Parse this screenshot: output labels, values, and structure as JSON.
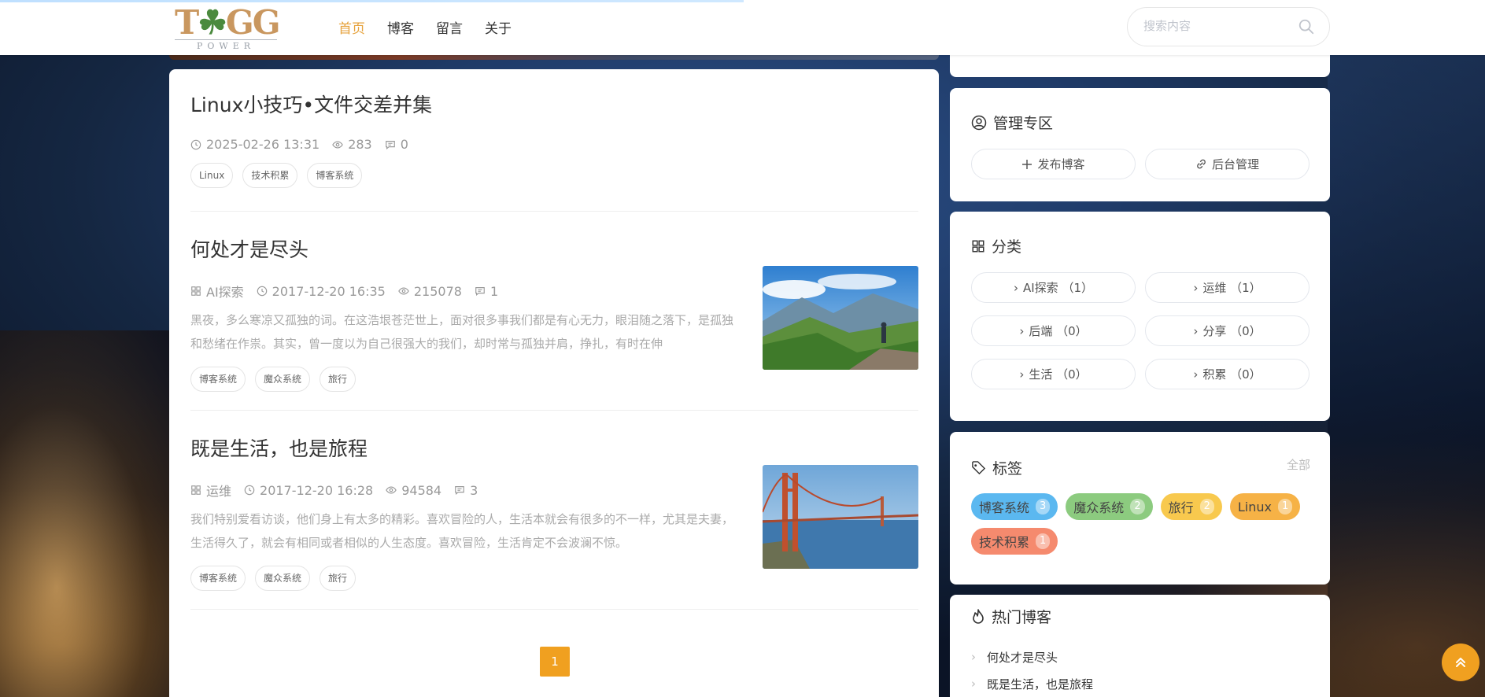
{
  "header": {
    "logo_text": "TOGG",
    "logo_sub": "POWER",
    "nav": [
      "首页",
      "博客",
      "留言",
      "关于"
    ],
    "search_placeholder": "搜索内容"
  },
  "posts": [
    {
      "title": "Linux小技巧•文件交差并集",
      "date": "2025-02-26 13:31",
      "views": "283",
      "comments": "0",
      "tags": [
        "Linux",
        "技术积累",
        "博客系统"
      ]
    },
    {
      "title": "何处才是尽头",
      "category": "AI探索",
      "date": "2017-12-20 16:35",
      "views": "215078",
      "comments": "1",
      "excerpt": "黑夜，多么寒凉又孤独的词。在这浩垠苍茫世上，面对很多事我们都是有心无力，眼泪随之落下，是孤独和愁绪在作祟。其实，曾一度以为自己很强大的我们，却时常与孤独并肩，挣扎，有时在伸",
      "tags": [
        "博客系统",
        "魔众系统",
        "旅行"
      ]
    },
    {
      "title": "既是生活，也是旅程",
      "category": "运维",
      "date": "2017-12-20 16:28",
      "views": "94584",
      "comments": "3",
      "excerpt": "我们特别爱看访谈，他们身上有太多的精彩。喜欢冒险的人，生活本就会有很多的不一样，尤其是夫妻，生活得久了，就会有相同或者相似的人生态度。喜欢冒险，生活肯定不会波澜不惊。",
      "tags": [
        "博客系统",
        "魔众系统",
        "旅行"
      ]
    }
  ],
  "pagination": {
    "current": "1"
  },
  "admin": {
    "title": "管理专区",
    "publish": "发布博客",
    "backend": "后台管理"
  },
  "categories": {
    "title": "分类",
    "items": [
      {
        "label": "AI探索 （1）"
      },
      {
        "label": "运维 （1）"
      },
      {
        "label": "后端 （0）"
      },
      {
        "label": "分享 （0）"
      },
      {
        "label": "生活 （0）"
      },
      {
        "label": "积累 （0）"
      }
    ]
  },
  "tags_panel": {
    "title": "标签",
    "all": "全部",
    "items": [
      {
        "name": "博客系统",
        "count": "3",
        "color": "#5bb8f0"
      },
      {
        "name": "魔众系统",
        "count": "2",
        "color": "#8ccb7f"
      },
      {
        "name": "旅行",
        "count": "2",
        "color": "#f8c94e"
      },
      {
        "name": "Linux",
        "count": "1",
        "color": "#f6b246"
      },
      {
        "name": "技术积累",
        "count": "1",
        "color": "#f58a6e"
      }
    ]
  },
  "hot": {
    "title": "热门博客",
    "items": [
      "何处才是尽头",
      "既是生活，也是旅程"
    ]
  },
  "colors": {
    "accent": "#f0a020",
    "nav_active": "#e6a23c"
  }
}
